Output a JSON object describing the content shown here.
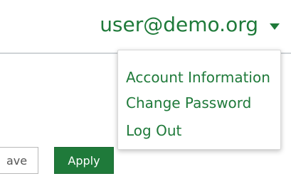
{
  "header": {
    "user_email": "user@demo.org",
    "caret_icon": "caret-down-icon"
  },
  "user_menu": {
    "items": [
      {
        "label": "Account Information"
      },
      {
        "label": "Change Password"
      },
      {
        "label": "Log Out"
      }
    ]
  },
  "form_actions": {
    "save_label": "ave",
    "apply_label": "Apply"
  },
  "colors": {
    "brand_green": "#1f7a3a",
    "divider": "#cfd3d6"
  }
}
